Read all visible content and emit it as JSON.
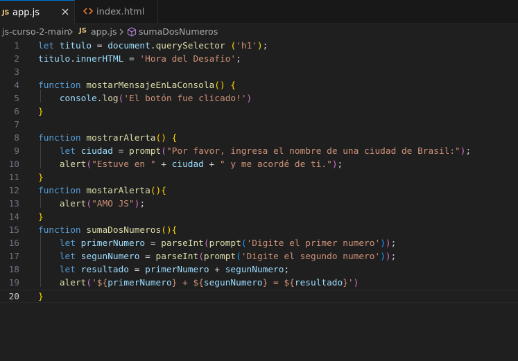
{
  "tabs": [
    {
      "icon": "JS",
      "label": "app.js",
      "active": true
    },
    {
      "icon": "<>",
      "label": "index.html",
      "active": false
    }
  ],
  "breadcrumb": {
    "folder": "js-curso-2-main",
    "file_icon": "JS",
    "file": "app.js",
    "symbol": "sumaDosNumeros"
  },
  "editor": {
    "current_line": 20,
    "lines": [
      {
        "n": "1",
        "tokens": [
          [
            "kw",
            "let"
          ],
          [
            "pl",
            " "
          ],
          [
            "vr",
            "titulo"
          ],
          [
            "pl",
            " = "
          ],
          [
            "vr",
            "document"
          ],
          [
            "pl",
            "."
          ],
          [
            "fn",
            "querySelector"
          ],
          [
            "pl",
            " "
          ],
          [
            "br",
            "("
          ],
          [
            "st",
            "'h1'"
          ],
          [
            "br",
            ")"
          ],
          [
            "pl",
            ";"
          ]
        ]
      },
      {
        "n": "2",
        "tokens": [
          [
            "vr",
            "titulo"
          ],
          [
            "pl",
            "."
          ],
          [
            "vr",
            "innerHTML"
          ],
          [
            "pl",
            " = "
          ],
          [
            "st",
            "'Hora del Desafío'"
          ],
          [
            "pl",
            ";"
          ]
        ]
      },
      {
        "n": "3",
        "tokens": []
      },
      {
        "n": "4",
        "tokens": [
          [
            "kw",
            "function"
          ],
          [
            "pl",
            " "
          ],
          [
            "fn",
            "mostarMensajeEnLaConsola"
          ],
          [
            "br",
            "()"
          ],
          [
            "pl",
            " "
          ],
          [
            "br",
            "{"
          ]
        ]
      },
      {
        "n": "5",
        "tokens": [
          [
            "pl",
            "    "
          ],
          [
            "vr",
            "console"
          ],
          [
            "pl",
            "."
          ],
          [
            "fn",
            "log"
          ],
          [
            "bm",
            "("
          ],
          [
            "st",
            "'El botón fue clicado!'"
          ],
          [
            "bm",
            ")"
          ]
        ]
      },
      {
        "n": "6",
        "tokens": [
          [
            "br",
            "}"
          ]
        ]
      },
      {
        "n": "7",
        "tokens": []
      },
      {
        "n": "8",
        "tokens": [
          [
            "kw",
            "function"
          ],
          [
            "pl",
            " "
          ],
          [
            "fn",
            "mostrarAlerta"
          ],
          [
            "br",
            "()"
          ],
          [
            "pl",
            " "
          ],
          [
            "br",
            "{"
          ]
        ]
      },
      {
        "n": "9",
        "tokens": [
          [
            "pl",
            "    "
          ],
          [
            "kw",
            "let"
          ],
          [
            "pl",
            " "
          ],
          [
            "vr",
            "ciudad"
          ],
          [
            "pl",
            " = "
          ],
          [
            "fn",
            "prompt"
          ],
          [
            "bm",
            "("
          ],
          [
            "st",
            "\"Por favor, ingresa el nombre de una ciudad de Brasil:\""
          ],
          [
            "bm",
            ")"
          ],
          [
            "pl",
            ";"
          ]
        ]
      },
      {
        "n": "10",
        "tokens": [
          [
            "pl",
            "    "
          ],
          [
            "fn",
            "alert"
          ],
          [
            "bm",
            "("
          ],
          [
            "st",
            "\"Estuve en \""
          ],
          [
            "pl",
            " + "
          ],
          [
            "vr",
            "ciudad"
          ],
          [
            "pl",
            " + "
          ],
          [
            "st",
            "\" y me acordé de ti.\""
          ],
          [
            "bm",
            ")"
          ],
          [
            "pl",
            ";"
          ]
        ]
      },
      {
        "n": "11",
        "tokens": [
          [
            "br",
            "}"
          ]
        ]
      },
      {
        "n": "12",
        "tokens": [
          [
            "kw",
            "function"
          ],
          [
            "pl",
            " "
          ],
          [
            "fn",
            "mostarAlerta"
          ],
          [
            "br",
            "(){"
          ]
        ]
      },
      {
        "n": "13",
        "tokens": [
          [
            "pl",
            "    "
          ],
          [
            "fn",
            "alert"
          ],
          [
            "bm",
            "("
          ],
          [
            "st",
            "\"AMO JS\""
          ],
          [
            "bm",
            ")"
          ],
          [
            "pl",
            ";"
          ]
        ]
      },
      {
        "n": "14",
        "tokens": [
          [
            "br",
            "}"
          ]
        ]
      },
      {
        "n": "15",
        "tokens": [
          [
            "kw",
            "function"
          ],
          [
            "pl",
            " "
          ],
          [
            "fn",
            "sumaDosNumeros"
          ],
          [
            "br",
            "(){"
          ]
        ]
      },
      {
        "n": "16",
        "tokens": [
          [
            "pl",
            "    "
          ],
          [
            "kw",
            "let"
          ],
          [
            "pl",
            " "
          ],
          [
            "vr",
            "primerNumero"
          ],
          [
            "pl",
            " = "
          ],
          [
            "fn",
            "parseInt"
          ],
          [
            "bm",
            "("
          ],
          [
            "fn",
            "prompt"
          ],
          [
            "bb",
            "("
          ],
          [
            "st",
            "'Digite el primer numero'"
          ],
          [
            "bb",
            ")"
          ],
          [
            "bm",
            ")"
          ],
          [
            "pl",
            ";"
          ]
        ]
      },
      {
        "n": "17",
        "tokens": [
          [
            "pl",
            "    "
          ],
          [
            "kw",
            "let"
          ],
          [
            "pl",
            " "
          ],
          [
            "vr",
            "segunNumero"
          ],
          [
            "pl",
            " = "
          ],
          [
            "fn",
            "parseInt"
          ],
          [
            "bm",
            "("
          ],
          [
            "fn",
            "prompt"
          ],
          [
            "bb",
            "("
          ],
          [
            "st",
            "'Digite el segundo numero'"
          ],
          [
            "bb",
            ")"
          ],
          [
            "bm",
            ")"
          ],
          [
            "pl",
            ";"
          ]
        ]
      },
      {
        "n": "18",
        "tokens": [
          [
            "pl",
            "    "
          ],
          [
            "kw",
            "let"
          ],
          [
            "pl",
            " "
          ],
          [
            "vr",
            "resultado"
          ],
          [
            "pl",
            " = "
          ],
          [
            "vr",
            "primerNumero"
          ],
          [
            "pl",
            " + "
          ],
          [
            "vr",
            "segunNumero"
          ],
          [
            "pl",
            ";"
          ]
        ]
      },
      {
        "n": "19",
        "tokens": [
          [
            "pl",
            "    "
          ],
          [
            "fn",
            "alert"
          ],
          [
            "bm",
            "("
          ],
          [
            "st",
            "'${"
          ],
          [
            "vr",
            "primerNumero"
          ],
          [
            "st",
            "} + ${"
          ],
          [
            "vr",
            "segunNumero"
          ],
          [
            "st",
            "} = ${"
          ],
          [
            "vr",
            "resultado"
          ],
          [
            "st",
            "}'"
          ],
          [
            "bm",
            ")"
          ]
        ]
      },
      {
        "n": "20",
        "tokens": [
          [
            "br",
            "}"
          ]
        ]
      }
    ]
  }
}
